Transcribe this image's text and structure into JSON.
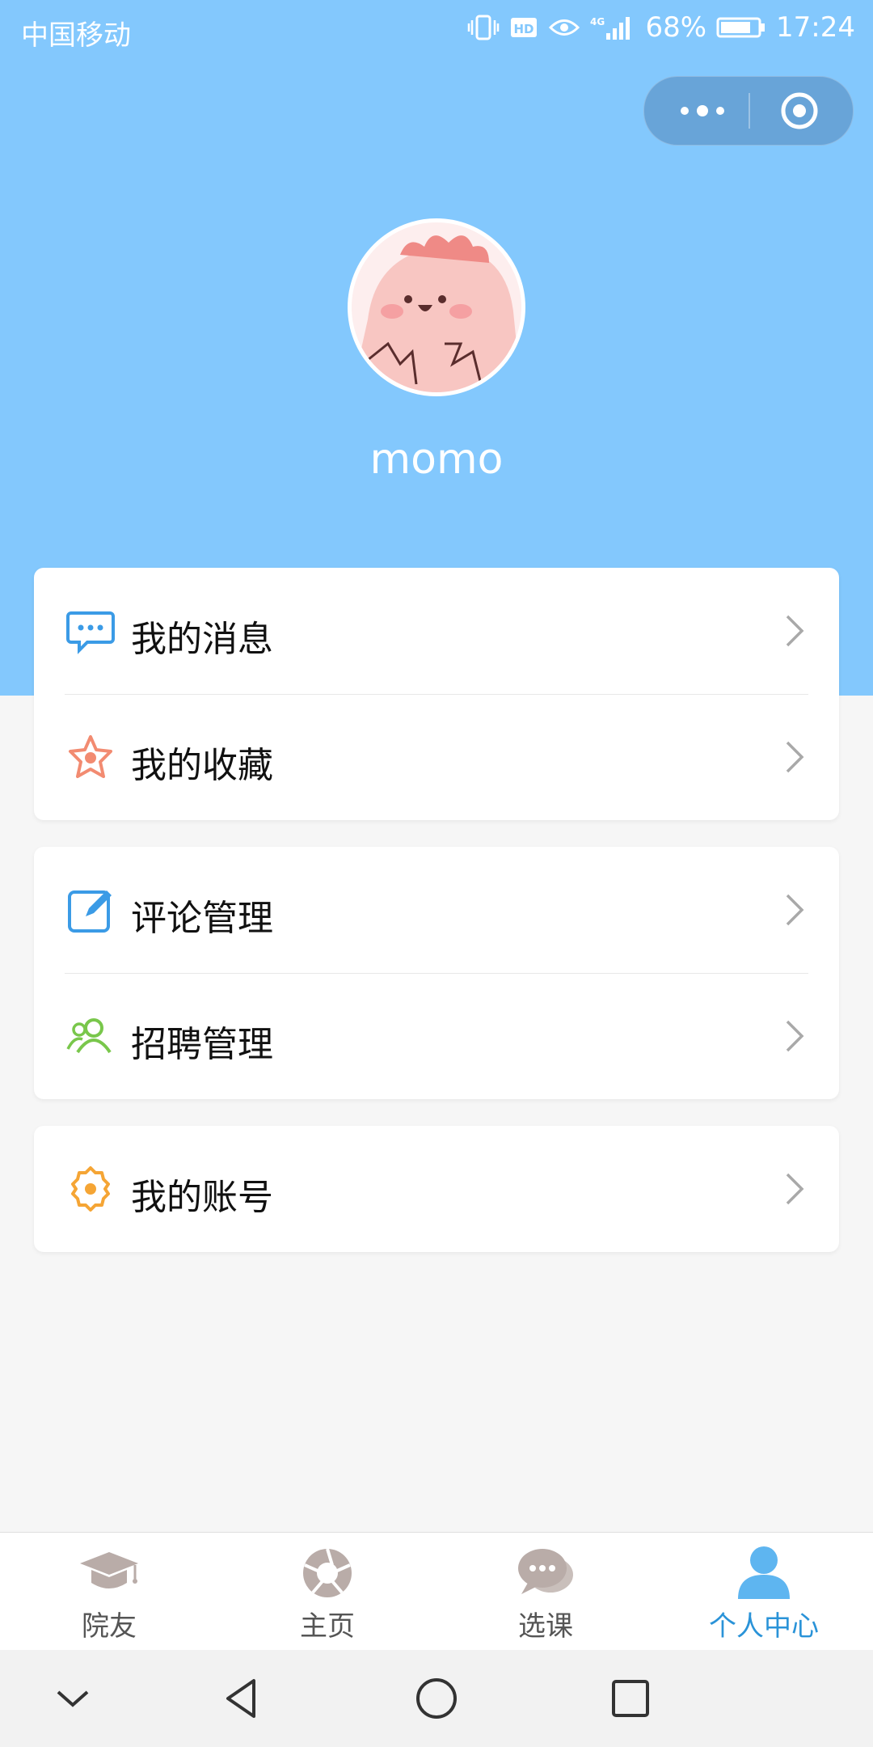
{
  "status_bar": {
    "carrier": "中国移动",
    "battery": "68%",
    "time": "17:24",
    "icons": [
      "vibrate-icon",
      "hd-icon",
      "eye-icon",
      "4g-signal-icon",
      "battery-icon"
    ]
  },
  "capsule": {
    "icons": [
      "more-dots-icon",
      "close-target-icon"
    ]
  },
  "profile": {
    "username": "momo"
  },
  "colors": {
    "header_blue": "#83c8fd",
    "active_tab": "#2a93d8",
    "message_icon": "#3b9be6",
    "favorite_icon": "#f28b71",
    "comment_icon": "#3b9be6",
    "recruit_icon": "#79c74b",
    "account_icon": "#f5a535"
  },
  "menu": {
    "group1": [
      {
        "label": "我的消息",
        "icon": "message-icon"
      },
      {
        "label": "我的收藏",
        "icon": "favorite-star-icon"
      }
    ],
    "group2": [
      {
        "label": "评论管理",
        "icon": "edit-comment-icon"
      },
      {
        "label": "招聘管理",
        "icon": "users-icon"
      }
    ],
    "group3": [
      {
        "label": "我的账号",
        "icon": "gear-icon"
      }
    ]
  },
  "tabbar": {
    "tabs": [
      {
        "label": "院友",
        "icon": "graduation-cap-icon"
      },
      {
        "label": "主页",
        "icon": "aperture-icon"
      },
      {
        "label": "选课",
        "icon": "chat-bubbles-icon"
      },
      {
        "label": "个人中心",
        "icon": "person-icon",
        "active": true
      }
    ]
  },
  "system_nav": {
    "icons": [
      "collapse-chevron-icon",
      "back-triangle-icon",
      "home-circle-icon",
      "recents-square-icon"
    ]
  }
}
